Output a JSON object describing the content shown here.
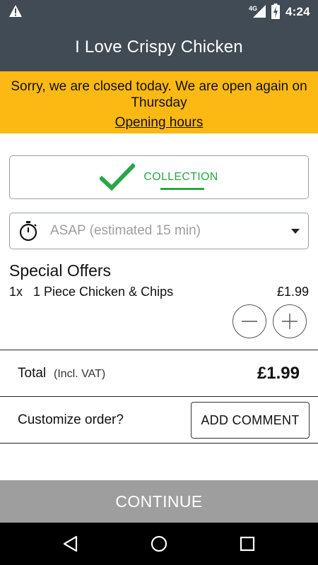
{
  "status_bar": {
    "time": "4:24",
    "network": "4G",
    "icons": [
      "warning-icon",
      "signal-icon",
      "battery-charging-icon"
    ]
  },
  "app_bar": {
    "title": "I Love Crispy Chicken"
  },
  "banner": {
    "message": "Sorry, we are closed today. We are open again on Thursday",
    "link": "Opening hours",
    "color": "#fdb913"
  },
  "delivery_mode": {
    "label": "COLLECTION",
    "icon": "checkmark-icon",
    "accent": "#27a844"
  },
  "time_select": {
    "value": "ASAP (estimated 15 min)",
    "icon": "stopwatch-icon"
  },
  "order": {
    "section_title": "Special Offers",
    "items": [
      {
        "qty": "1x",
        "name": "1 Piece Chicken & Chips",
        "price": "£1.99"
      }
    ]
  },
  "totals": {
    "label": "Total",
    "vat_note": "(Incl. VAT)",
    "value": "£1.99"
  },
  "customize": {
    "label": "Customize order?",
    "button": "ADD COMMENT"
  },
  "continue_button": {
    "label": "CONTINUE"
  },
  "nav_bar": {
    "icons": [
      "back-icon",
      "home-icon",
      "recent-apps-icon"
    ]
  }
}
